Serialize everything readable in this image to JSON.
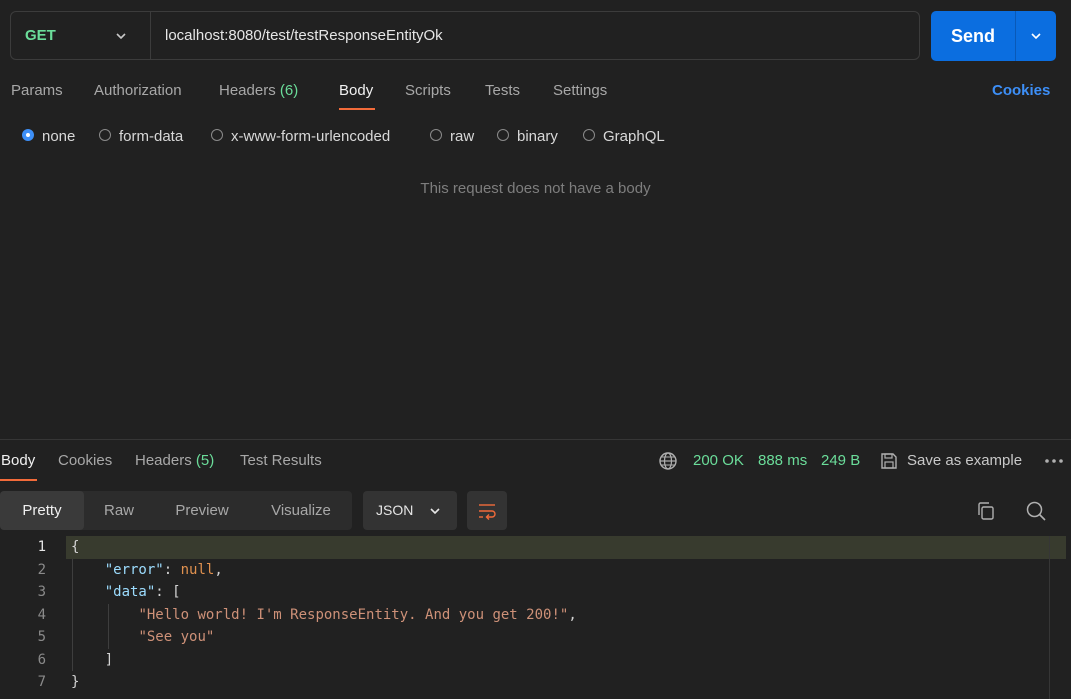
{
  "request": {
    "method": "GET",
    "url": "localhost:8080/test/testResponseEntityOk",
    "send_label": "Send"
  },
  "request_tabs": [
    {
      "label": "Params",
      "count": ""
    },
    {
      "label": "Authorization",
      "count": ""
    },
    {
      "label": "Headers",
      "count": "(6)"
    },
    {
      "label": "Body",
      "count": "",
      "active": true
    },
    {
      "label": "Scripts",
      "count": ""
    },
    {
      "label": "Tests",
      "count": ""
    },
    {
      "label": "Settings",
      "count": ""
    }
  ],
  "cookies_link": "Cookies",
  "body_types": [
    {
      "label": "none",
      "selected": true
    },
    {
      "label": "form-data"
    },
    {
      "label": "x-www-form-urlencoded"
    },
    {
      "label": "raw"
    },
    {
      "label": "binary"
    },
    {
      "label": "GraphQL"
    }
  ],
  "empty_body_message": "This request does not have a body",
  "response_tabs": [
    {
      "label": "Body",
      "count": "",
      "active": true
    },
    {
      "label": "Cookies",
      "count": ""
    },
    {
      "label": "Headers",
      "count": "(5)"
    },
    {
      "label": "Test Results",
      "count": ""
    }
  ],
  "response_status": {
    "status": "200 OK",
    "time": "888 ms",
    "size": "249 B",
    "save_label": "Save as example"
  },
  "view_modes": [
    "Pretty",
    "Raw",
    "Preview",
    "Visualize"
  ],
  "active_view": "Pretty",
  "format": "JSON",
  "code_lines": {
    "l1": "{",
    "l2_key": "\"error\"",
    "l2_val": "null",
    "l3_key": "\"data\"",
    "l3_open": "[",
    "l4": "\"Hello world! I'm ResponseEntity. And you get 200!\"",
    "l5": "\"See you\"",
    "l6": "]",
    "l7": "}"
  },
  "line_numbers": [
    "1",
    "2",
    "3",
    "4",
    "5",
    "6",
    "7"
  ],
  "colors": {
    "accent": "#f26b3a",
    "send": "#0b6ee0",
    "status_ok": "#6bdd9a",
    "link": "#3d8ff7"
  }
}
